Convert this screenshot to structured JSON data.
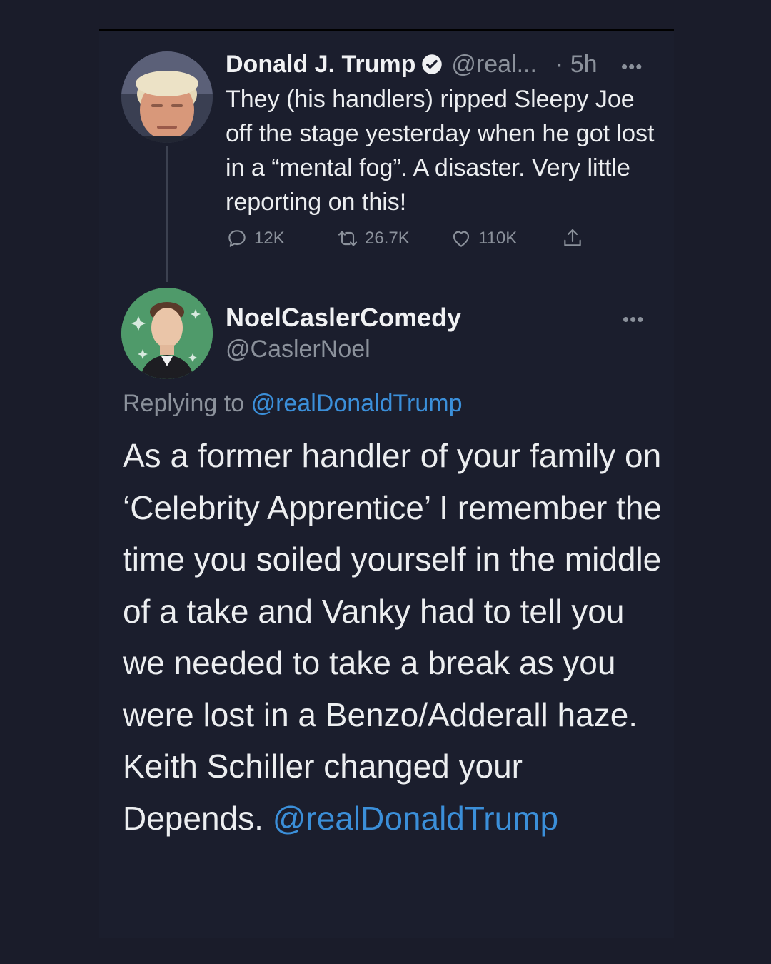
{
  "tweet": {
    "author_name": "Donald J. Trump",
    "handle": "@real...",
    "time": "· 5h",
    "body": "They (his handlers) ripped Sleepy Joe off the stage yesterday when he got lost in a “mental fog”. A disaster. Very little reporting on this!",
    "replies": "12K",
    "retweets": "26.7K",
    "likes": "110K"
  },
  "reply": {
    "author_name": "NoelCaslerComedy",
    "handle": "@CaslerNoel",
    "replying_prefix": "Replying to",
    "replying_to": "@realDonaldTrump",
    "body_text": "As a former handler of your family on ‘Celebrity Apprentice’ I remember the time you soiled yourself in the middle of a take and Vanky had to tell you we needed to take a break as you were lost in a Benzo/Adderall haze. Keith Schiller changed your Depends.",
    "body_mention": "@realDonaldTrump"
  },
  "icons": {
    "verified": "verified-badge-icon",
    "more": "more-options-icon",
    "reply": "reply-icon",
    "retweet": "retweet-icon",
    "like": "heart-icon",
    "share": "share-icon"
  },
  "colors": {
    "background": "#1a1c2a",
    "link": "#3b8fd9",
    "muted": "#8b919b"
  }
}
